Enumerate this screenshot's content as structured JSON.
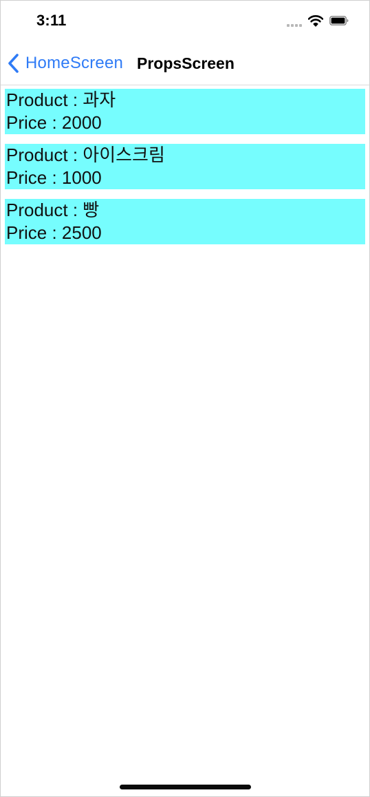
{
  "status_bar": {
    "time": "3:11",
    "icons": [
      "cellular-signal-icon",
      "wifi-icon",
      "battery-icon"
    ]
  },
  "header": {
    "back_label": "HomeScreen",
    "back_icon": "chevron-left-icon",
    "title": "PropsScreen",
    "accent_color": "#2f7bf6"
  },
  "products": [
    {
      "product_label": "Product : 과자",
      "price_label": "Price : 2000"
    },
    {
      "product_label": "Product : 아이스크림",
      "price_label": "Price : 1000"
    },
    {
      "product_label": "Product : 빵",
      "price_label": "Price : 2500"
    }
  ],
  "colors": {
    "card_background": "#76fdfe"
  }
}
